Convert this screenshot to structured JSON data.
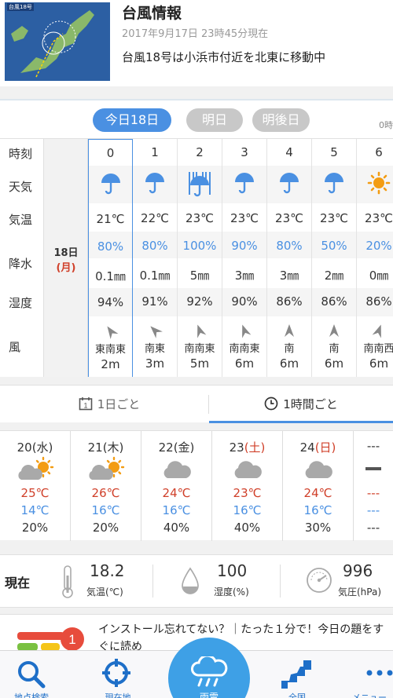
{
  "typhoon": {
    "map_label": "台風18号",
    "title": "台風情報",
    "time": "2017年9月17日 23時45分現在",
    "message": "台風18号は小浜市付近を北東に移動中"
  },
  "day_tabs": [
    "今日18日",
    "明日",
    "明後日"
  ],
  "day_tabs_edge": "0時",
  "row_labels": [
    "時刻",
    "天気",
    "気温",
    "降水",
    "湿度",
    "風"
  ],
  "date": {
    "day": "18日",
    "weekday": "(月)"
  },
  "hours": [
    {
      "hour": "0",
      "weather": "umbrella-icon",
      "temp": "21℃",
      "precip_prob": "80%",
      "precip_amt": "0.1㎜",
      "humidity": "94%",
      "wind_dir": "東南東",
      "wind_speed": "2m"
    },
    {
      "hour": "1",
      "weather": "umbrella-icon",
      "temp": "22℃",
      "precip_prob": "80%",
      "precip_amt": "0.1㎜",
      "humidity": "91%",
      "wind_dir": "南東",
      "wind_speed": "3m"
    },
    {
      "hour": "2",
      "weather": "heavy-rain-icon",
      "temp": "23℃",
      "precip_prob": "100%",
      "precip_amt": "5㎜",
      "humidity": "92%",
      "wind_dir": "南南東",
      "wind_speed": "5m"
    },
    {
      "hour": "3",
      "weather": "umbrella-icon",
      "temp": "23℃",
      "precip_prob": "90%",
      "precip_amt": "3㎜",
      "humidity": "90%",
      "wind_dir": "南南東",
      "wind_speed": "6m"
    },
    {
      "hour": "4",
      "weather": "umbrella-icon",
      "temp": "23℃",
      "precip_prob": "80%",
      "precip_amt": "3㎜",
      "humidity": "86%",
      "wind_dir": "南",
      "wind_speed": "6m"
    },
    {
      "hour": "5",
      "weather": "umbrella-icon",
      "temp": "23℃",
      "precip_prob": "50%",
      "precip_amt": "2㎜",
      "humidity": "86%",
      "wind_dir": "南",
      "wind_speed": "6m"
    },
    {
      "hour": "6",
      "weather": "sun-icon",
      "temp": "23℃",
      "precip_prob": "20%",
      "precip_amt": "0㎜",
      "humidity": "86%",
      "wind_dir": "南南西",
      "wind_speed": "6m"
    }
  ],
  "period_tabs": [
    "1日ごと",
    "1時間ごと"
  ],
  "weekly": [
    {
      "date": "20",
      "dow": "(水)",
      "icon": "cloud-sun-icon",
      "high": "25℃",
      "low": "14℃",
      "precip": "20%"
    },
    {
      "date": "21",
      "dow": "(木)",
      "icon": "cloud-sun-icon",
      "high": "26℃",
      "low": "16℃",
      "precip": "20%"
    },
    {
      "date": "22",
      "dow": "(金)",
      "icon": "cloud-icon",
      "high": "24℃",
      "low": "16℃",
      "precip": "40%"
    },
    {
      "date": "23",
      "dow": "(土)",
      "icon": "cloud-icon",
      "high": "23℃",
      "low": "16℃",
      "precip": "40%"
    },
    {
      "date": "24",
      "dow": "(日)",
      "icon": "cloud-icon",
      "high": "24℃",
      "low": "16℃",
      "precip": "30%"
    },
    {
      "date": "---",
      "dow": "",
      "icon": "dash-icon",
      "high": "---",
      "low": "---",
      "precip": "---"
    }
  ],
  "current": {
    "label": "現在",
    "temp": "18.2",
    "temp_label": "気温(℃)",
    "humidity": "100",
    "humidity_label": "湿度(%)",
    "pressure": "996",
    "pressure_label": "気圧(hPa)"
  },
  "news": {
    "badge": "1",
    "text": "インストール忘れてない？｜たった１分で！今日の題をすぐに読め"
  },
  "nav": [
    "地点検索",
    "現在地",
    "雨雲",
    "全国",
    "メニュー"
  ],
  "colors": {
    "accent": "#4a90e2",
    "warm": "#d0402a",
    "sun": "#f39c12",
    "rain_button": "#3ea0e6"
  }
}
